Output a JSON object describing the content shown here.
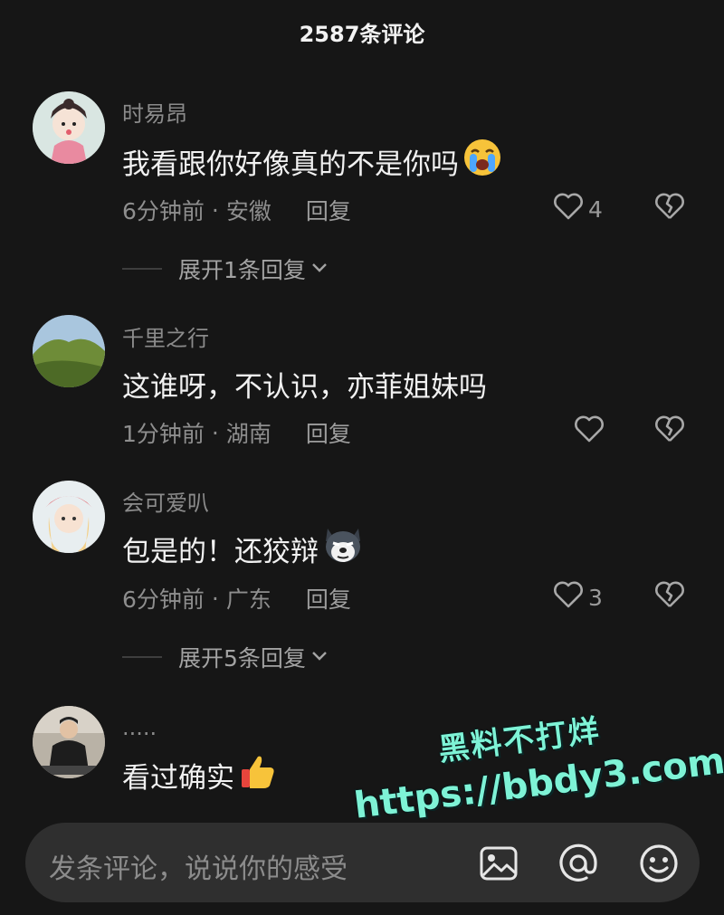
{
  "header": {
    "title": "2587条评论"
  },
  "comments": [
    {
      "username": "时易昂",
      "text": "我看跟你好像真的不是你吗",
      "emoji": "loudly-crying-face",
      "time": "6分钟前",
      "separator": "·",
      "location": "安徽",
      "reply_label": "回复",
      "likes": "4",
      "expand_text": "展开1条回复"
    },
    {
      "username": "千里之行",
      "text": "这谁呀，不认识，亦菲姐妹吗",
      "time": "1分钟前",
      "separator": "·",
      "location": "湖南",
      "reply_label": "回复",
      "likes": ""
    },
    {
      "username": "会可爱叭",
      "text": "包是的！还狡辩",
      "emoji": "husky-dog-face",
      "time": "6分钟前",
      "separator": "·",
      "location": "广东",
      "reply_label": "回复",
      "likes": "3",
      "expand_text": "展开5条回复"
    },
    {
      "username": ".....",
      "text": "看过确实",
      "emoji": "thumbs-up"
    }
  ],
  "watermark": {
    "line1": "黑料不打烊",
    "line2": "https://bbdy3.com"
  },
  "input": {
    "placeholder": "发条评论，说说你的感受"
  },
  "icons": {
    "like": "heart-outline-icon",
    "dislike": "broken-heart-icon",
    "expand": "chevron-down-icon",
    "image": "image-icon",
    "mention": "at-sign-icon",
    "emoji": "smiley-icon"
  },
  "colors": {
    "background": "#161616",
    "input_bg": "#2f2f2f",
    "watermark": "#7ef3d6"
  }
}
